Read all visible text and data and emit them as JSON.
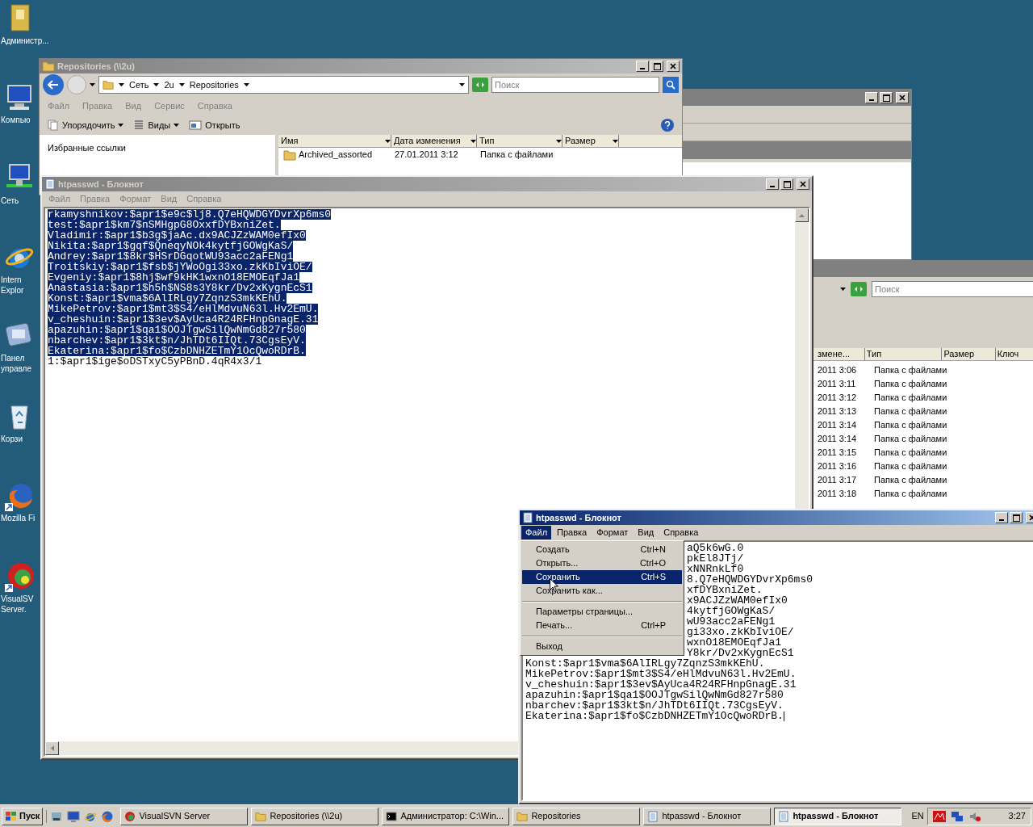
{
  "desktop_icons": [
    {
      "kind": "user-folder",
      "label_lines": [
        "Администр..."
      ]
    },
    {
      "kind": "computer",
      "label_lines": [
        "Компью"
      ]
    },
    {
      "kind": "network",
      "label_lines": [
        "Сеть"
      ]
    },
    {
      "kind": "browser",
      "label_lines": [
        "Intern",
        "Explor"
      ]
    },
    {
      "kind": "control-panel",
      "label_lines": [
        "Панел",
        "управле"
      ]
    },
    {
      "kind": "recycle-bin",
      "label_lines": [
        "Корзи"
      ]
    },
    {
      "kind": "firefox",
      "label_lines": [
        "Mozilla Fi"
      ]
    },
    {
      "kind": "visualsvn",
      "label_lines": [
        "VisualSV",
        "Server."
      ]
    }
  ],
  "explorer_right": {
    "search": {
      "placeholder": "Поиск"
    },
    "columns": [
      "змене...",
      "Тип",
      "Размер",
      "Ключ"
    ],
    "rows": [
      {
        "date": "2011 3:06",
        "type": "Папка с файлами"
      },
      {
        "date": "2011 3:11",
        "type": "Папка с файлами"
      },
      {
        "date": "2011 3:12",
        "type": "Папка с файлами"
      },
      {
        "date": "2011 3:13",
        "type": "Папка с файлами"
      },
      {
        "date": "2011 3:14",
        "type": "Папка с файлами"
      },
      {
        "date": "2011 3:14",
        "type": "Папка с файлами"
      },
      {
        "date": "2011 3:15",
        "type": "Папка с файлами"
      },
      {
        "date": "2011 3:16",
        "type": "Папка с файлами"
      },
      {
        "date": "2011 3:17",
        "type": "Папка с файлами"
      },
      {
        "date": "2011 3:18",
        "type": "Папка с файлами"
      }
    ]
  },
  "explorer_main": {
    "title": "Repositories (\\\\2u)",
    "breadcrumb": [
      "Сеть",
      "2u",
      "Repositories"
    ],
    "search": {
      "placeholder": "Поиск"
    },
    "menu": [
      "Файл",
      "Правка",
      "Вид",
      "Сервис",
      "Справка"
    ],
    "toolbar": [
      {
        "kind": "organize",
        "label": "Упорядочить"
      },
      {
        "kind": "views",
        "label": "Виды"
      },
      {
        "kind": "open",
        "label": "Открыть"
      }
    ],
    "favorites_title": "Избранные ссылки",
    "columns": [
      "Имя",
      "Дата изменения",
      "Тип",
      "Размер"
    ],
    "rows": [
      {
        "name": "Archived_assorted",
        "date": "27.01.2011 3:12",
        "type": "Папка с файлами"
      }
    ]
  },
  "notepad_back": {
    "title": "htpasswd - Блокнот",
    "active": false,
    "menu": [
      "Файл",
      "Правка",
      "Формат",
      "Вид",
      "Справка"
    ],
    "lines": [
      {
        "text": "rkamyshnikov:$apr1$e9c$lj8.Q7eHQWDGYDvrXp6ms0",
        "selected": true
      },
      {
        "text": "test:$apr1$km7$nSMHgpG8OxxfDYBxniZet.",
        "selected": true
      },
      {
        "text": "Vladimir:$apr1$b3g$jaAc.dx9ACJZzWAM0efIx0",
        "selected": true
      },
      {
        "text": "Nikita:$apr1$gqf$QneqyNOk4kytfjGOWgKaS/",
        "selected": true
      },
      {
        "text": "Andrey:$apr1$8kr$HSrDGqotWU93acc2aFENg1",
        "selected": true
      },
      {
        "text": "Troitskiy:$apr1$fsb$jYWoOgi33xo.zkKbIviOE/",
        "selected": true
      },
      {
        "text": "Evgeniy:$apr1$8hj$wf9kHK1wxnO18EMOEqfJa1",
        "selected": true
      },
      {
        "text": "Anastasia:$apr1$h5h$NS8s3Y8kr/Dv2xKygnEcS1",
        "selected": true
      },
      {
        "text": "Konst:$apr1$vma$6AlIRLgy7ZqnzS3mkKEhU.",
        "selected": true
      },
      {
        "text": "MikePetrov:$apr1$mt3$S4/eHlMdvuN63l.Hv2EmU.",
        "selected": true
      },
      {
        "text": "v_cheshuin:$apr1$3ev$AyUca4R24RFHnpGnagE.31",
        "selected": true
      },
      {
        "text": "apazuhin:$apr1$qa1$OOJTgwSilQwNmGd827r580",
        "selected": true
      },
      {
        "text": "nbarchev:$apr1$3kt$n/JhTDt6IIQt.73CgsEyV.",
        "selected": true
      },
      {
        "text": "Ekaterina:$apr1$fo$CzbDNHZETmY1OcQwoRDrB.",
        "selected": true
      },
      {
        "text": "1:$apr1$ige$oDSTxyC5yPBnD.4qR4x3/1",
        "selected": false
      }
    ]
  },
  "notepad_front": {
    "title": "htpasswd - Блокнот",
    "active": true,
    "menu": [
      {
        "label": "Файл",
        "selected": true
      },
      {
        "label": "Правка",
        "selected": false
      },
      {
        "label": "Формат",
        "selected": false
      },
      {
        "label": "Вид",
        "selected": false
      },
      {
        "label": "Справка",
        "selected": false
      }
    ],
    "file_menu": [
      {
        "kind": "item",
        "label": "Создать",
        "shortcut": "Ctrl+N",
        "selected": false
      },
      {
        "kind": "item",
        "label": "Открыть...",
        "shortcut": "Ctrl+O",
        "selected": false
      },
      {
        "kind": "item",
        "label": "Сохранить",
        "shortcut": "Ctrl+S",
        "selected": true
      },
      {
        "kind": "item",
        "label": "Сохранить как...",
        "selected": false
      },
      {
        "kind": "separator"
      },
      {
        "kind": "item",
        "label": "Параметры страницы...",
        "selected": false
      },
      {
        "kind": "item",
        "label": "Печать...",
        "shortcut": "Ctrl+P",
        "selected": false
      },
      {
        "kind": "separator"
      },
      {
        "kind": "item",
        "label": "Выход",
        "selected": false
      }
    ],
    "lines": [
      {
        "kind": "partial",
        "text": "aQ5k6wG.0"
      },
      {
        "kind": "partial",
        "text": "pkEl8JTj/"
      },
      {
        "kind": "partial",
        "text": "xNNRnkLf0"
      },
      {
        "kind": "partial",
        "text": "8.Q7eHQWDGYDvrXp6ms0"
      },
      {
        "kind": "partial",
        "text": "xfDYBxniZet."
      },
      {
        "kind": "partial",
        "text": "x9ACJZzWAM0efIx0"
      },
      {
        "kind": "partial",
        "text": "4kytfjGOWgKaS/"
      },
      {
        "kind": "partial",
        "text": "wU93acc2aFENg1"
      },
      {
        "kind": "partial",
        "text": "gi33xo.zkKbIviOE/"
      },
      {
        "kind": "partial",
        "text": "wxnO18EMOEqfJa1"
      },
      {
        "kind": "partial",
        "text": "Y8kr/Dv2xKygnEcS1"
      },
      {
        "kind": "full",
        "text": "Konst:$apr1$vma$6AlIRLgy7ZqnzS3mkKEhU."
      },
      {
        "kind": "full",
        "text": "MikePetrov:$apr1$mt3$S4/eHlMdvuN63l.Hv2EmU."
      },
      {
        "kind": "full",
        "text": "v_cheshuin:$apr1$3ev$AyUca4R24RFHnpGnagE.31"
      },
      {
        "kind": "full",
        "text": "apazuhin:$apr1$qa1$OOJTgwSilQwNmGd827r580"
      },
      {
        "kind": "full",
        "text": "nbarchev:$apr1$3kt$n/JhTDt6IIQt.73CgsEyV."
      },
      {
        "kind": "full",
        "text": "Ekaterina:$apr1$fo$CzbDNHZETmY1OcQwoRDrB."
      }
    ]
  },
  "taskbar": {
    "start": "Пуск",
    "tasks": [
      {
        "kind": "visualsvn",
        "label": "VisualSVN Server",
        "selected": false
      },
      {
        "kind": "folder",
        "label": "Repositories (\\\\2u)",
        "selected": false
      },
      {
        "kind": "console",
        "label": "Администратор: C:\\Win...",
        "selected": false
      },
      {
        "kind": "folder",
        "label": "Repositories",
        "selected": false
      },
      {
        "kind": "notepad",
        "label": "htpasswd - Блокнот",
        "selected": false
      },
      {
        "kind": "notepad",
        "label": "htpasswd - Блокнот",
        "selected": true
      }
    ],
    "language": "EN",
    "clock": "3:27"
  }
}
